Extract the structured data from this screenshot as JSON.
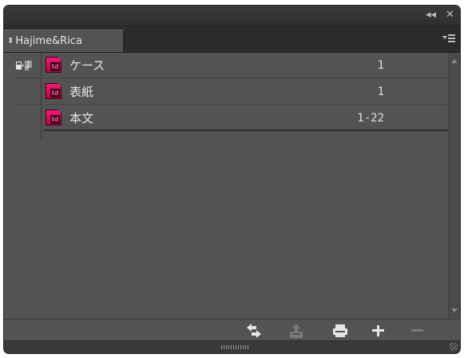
{
  "window": {
    "collapse_glyph": "◂◂",
    "close_glyph": "✕"
  },
  "tab": {
    "label": "Hajime&Rica",
    "arrows_glyph": "⬍"
  },
  "book": {
    "documents": [
      {
        "name": "ケース",
        "pages": "1",
        "icon": "indesign-doc-icon",
        "icon_text": "Id"
      },
      {
        "name": "表紙",
        "pages": "1",
        "icon": "indesign-doc-icon",
        "icon_text": "Id"
      },
      {
        "name": "本文",
        "pages": "1-22",
        "icon": "indesign-doc-icon",
        "icon_text": "Id"
      }
    ],
    "style_source_icon": "style-source-sync-icon"
  },
  "footer": {
    "buttons": [
      {
        "name": "synchronize-icon",
        "enabled": true
      },
      {
        "name": "save-book-icon",
        "enabled": false
      },
      {
        "name": "print-book-icon",
        "enabled": true
      },
      {
        "name": "add-document-icon",
        "enabled": true
      },
      {
        "name": "remove-document-icon",
        "enabled": false
      }
    ]
  },
  "colors": {
    "panel_bg": "#535353",
    "titlebar_bg": "#2f2f2f",
    "text": "#e8e8e8",
    "indesign_pink": "#f01b75",
    "indesign_dark": "#3c0017"
  }
}
